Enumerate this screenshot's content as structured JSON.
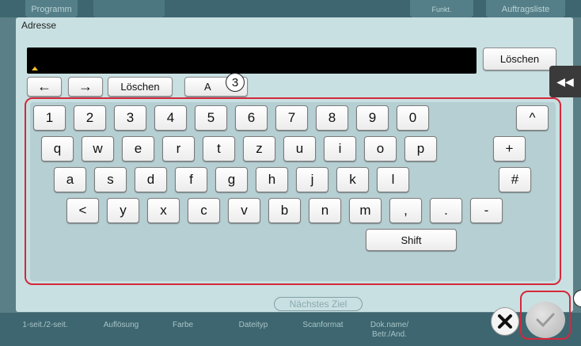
{
  "background": {
    "top_tabs": [
      "Programm",
      "Funkt.",
      "Auftragsliste"
    ],
    "bottom_labels": [
      "1-seit./2-seit.",
      "Auflösung",
      "Farbe",
      "Dateityp",
      "Scanformat",
      "Dok.name/\nBetr./And."
    ]
  },
  "dialog": {
    "title": "Adresse",
    "address_value": "",
    "clear_field_label": "Löschen",
    "cursor_left_icon": "←",
    "cursor_right_icon": "→",
    "delete_label": "Löschen",
    "mode_label": "A",
    "callout_number": "3",
    "next_destination_label": "Nächstes Ziel"
  },
  "keyboard": {
    "row1": [
      "1",
      "2",
      "3",
      "4",
      "5",
      "6",
      "7",
      "8",
      "9",
      "0"
    ],
    "row1_extra": "^",
    "row2": [
      "q",
      "w",
      "e",
      "r",
      "t",
      "z",
      "u",
      "i",
      "o",
      "p"
    ],
    "row2_extra": "+",
    "row3": [
      "a",
      "s",
      "d",
      "f",
      "g",
      "h",
      "j",
      "k",
      "l"
    ],
    "row3_extra": "#",
    "row4": [
      "<",
      "y",
      "x",
      "c",
      "v",
      "b",
      "n",
      "m",
      ",",
      ".",
      "-"
    ],
    "shift_label": "Shift"
  },
  "controls": {
    "side_tab_icon": "◀◀",
    "cancel_icon": "close-icon",
    "ok_icon": "check-icon"
  },
  "colors": {
    "highlight_frame": "#d6273a",
    "dialog_bg": "#c9e0e2",
    "keyboard_bg": "#b6cfd2",
    "address_field": "#000000"
  }
}
